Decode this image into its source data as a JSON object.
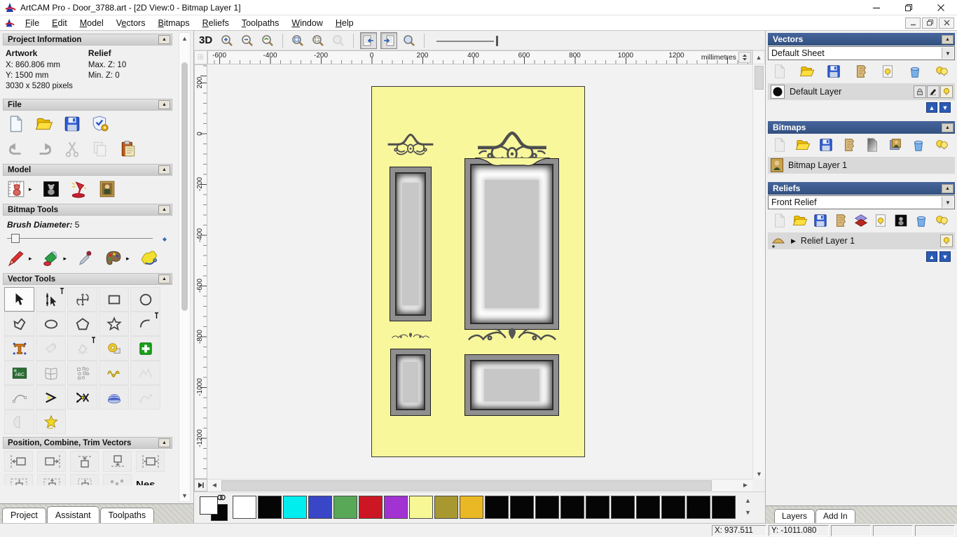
{
  "window": {
    "title": "ArtCAM Pro - Door_3788.art - [2D View:0 - Bitmap Layer 1]",
    "menus": [
      {
        "pre": "",
        "key": "F",
        "rest": "ile"
      },
      {
        "pre": "",
        "key": "E",
        "rest": "dit"
      },
      {
        "pre": "",
        "key": "M",
        "rest": "odel"
      },
      {
        "pre": "V",
        "key": "e",
        "rest": "ctors"
      },
      {
        "pre": "",
        "key": "B",
        "rest": "itmaps"
      },
      {
        "pre": "",
        "key": "R",
        "rest": "eliefs"
      },
      {
        "pre": "",
        "key": "T",
        "rest": "oolpaths"
      },
      {
        "pre": "",
        "key": "W",
        "rest": "indow"
      },
      {
        "pre": "",
        "key": "H",
        "rest": "elp"
      }
    ]
  },
  "left_panel": {
    "project_information": {
      "title": "Project Information",
      "artwork_heading": "Artwork",
      "relief_heading": "Relief",
      "artwork_x": "X: 860.806 mm",
      "artwork_y": "Y: 1500 mm",
      "artwork_pixels": "3030 x 5280 pixels",
      "relief_max_z": "Max. Z: 10",
      "relief_min_z": "Min. Z: 0"
    },
    "file_section": {
      "title": "File"
    },
    "model_section": {
      "title": "Model"
    },
    "bitmap_tools": {
      "title": "Bitmap Tools",
      "brush_diameter_label": "Brush Diameter:",
      "brush_diameter_value": "5"
    },
    "vector_tools": {
      "title": "Vector Tools"
    },
    "position_section": {
      "title": "Position, Combine, Trim Vectors",
      "nesting_label": "Nes"
    },
    "tabs": {
      "project": "Project",
      "assistant": "Assistant",
      "toolpaths": "Toolpaths"
    }
  },
  "toolbar": {
    "view_3d": "3D"
  },
  "rulers": {
    "horizontal_ticks": [
      "-600",
      "-400",
      "-200",
      "0",
      "200",
      "400",
      "600",
      "800",
      "1000",
      "1200"
    ],
    "vertical_ticks": [
      "200",
      "0",
      "-200",
      "-400",
      "-600",
      "-800",
      "-1000",
      "-1200"
    ],
    "units": "millimetres"
  },
  "palette": {
    "swatches": [
      "#ffffff",
      "#050505",
      "#00eeee",
      "#3a46c8",
      "#58a858",
      "#cc1624",
      "#a232d2",
      "#f8f796",
      "#a89830",
      "#eab824",
      "#050505",
      "#050505",
      "#050505",
      "#050505",
      "#050505",
      "#050505",
      "#050505",
      "#050505",
      "#050505",
      "#050505"
    ]
  },
  "right_panel": {
    "vectors": {
      "title": "Vectors",
      "sheet_selector": "Default Sheet",
      "layer_name": "Default Layer"
    },
    "bitmaps": {
      "title": "Bitmaps",
      "layer_name": "Bitmap Layer 1"
    },
    "reliefs": {
      "title": "Reliefs",
      "relief_selector": "Front Relief",
      "layer_name": "Relief Layer 1"
    },
    "tabs": {
      "layers": "Layers",
      "add_in": "Add In"
    }
  },
  "status_bar": {
    "cells": [
      "X: 937.511",
      "Y: -1011.080",
      "",
      "",
      ""
    ]
  },
  "colors": {
    "panel_header_blue": "#3a5a93",
    "door_background_yellow": "#f8f79c",
    "ornament_gray": "#4e4e4e"
  }
}
